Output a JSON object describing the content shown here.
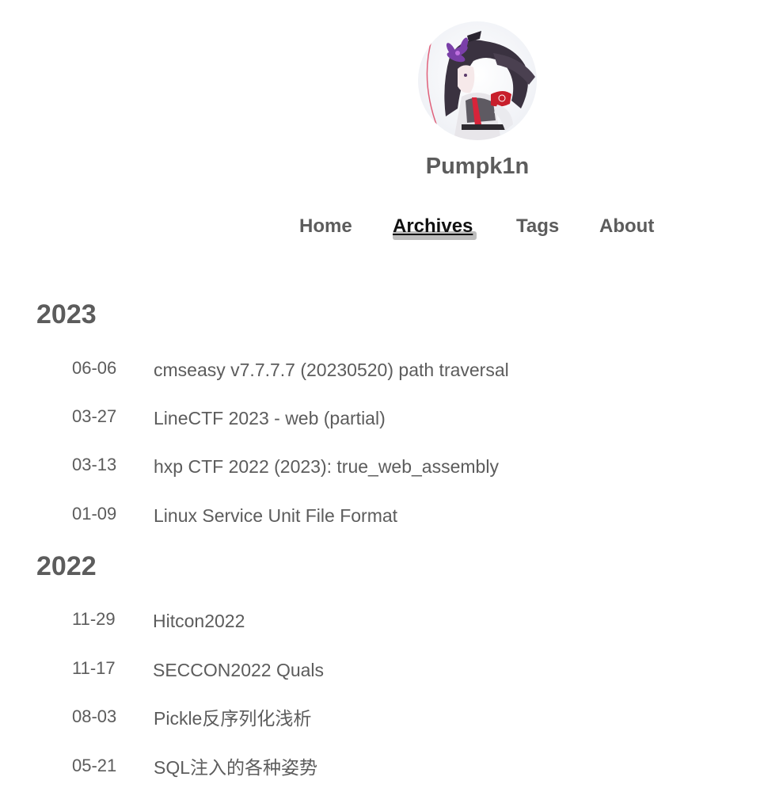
{
  "site": {
    "title": "Pumpk1n",
    "avatar_alt": "avatar"
  },
  "nav": {
    "items": [
      {
        "label": "Home",
        "active": false
      },
      {
        "label": "Archives",
        "active": true
      },
      {
        "label": "Tags",
        "active": false
      },
      {
        "label": "About",
        "active": false
      }
    ]
  },
  "archives": [
    {
      "year": "2023",
      "posts": [
        {
          "date": "06-06",
          "title": "cmseasy v7.7.7.7 (20230520) path traversal"
        },
        {
          "date": "03-27",
          "title": "LineCTF 2023 - web (partial)"
        },
        {
          "date": "03-13",
          "title": "hxp CTF 2022 (2023): true_web_assembly"
        },
        {
          "date": "01-09",
          "title": "Linux Service Unit File Format"
        }
      ]
    },
    {
      "year": "2022",
      "posts": [
        {
          "date": "11-29",
          "title": "Hitcon2022"
        },
        {
          "date": "11-17",
          "title": "SECCON2022 Quals"
        },
        {
          "date": "08-03",
          "title": "Pickle反序列化浅析"
        },
        {
          "date": "05-21",
          "title": "SQL注入的各种姿势"
        }
      ]
    }
  ]
}
